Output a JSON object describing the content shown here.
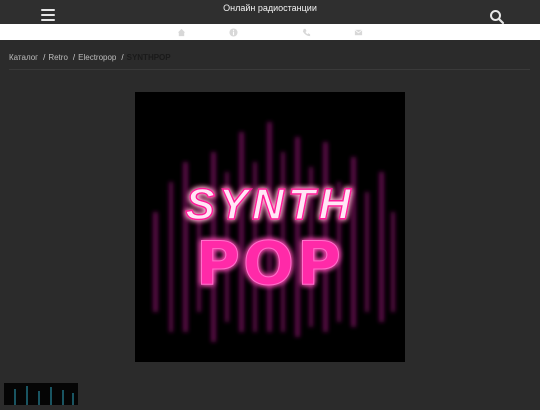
{
  "header": {
    "title": "Онлайн радиостанции",
    "menu_icon": "hamburger-icon",
    "search_icon": "search-icon"
  },
  "iconbar": {
    "icons": [
      "home-icon",
      "info-icon",
      "phone-icon",
      "mail-icon"
    ]
  },
  "breadcrumb": {
    "items": [
      "Каталог",
      "Retro",
      "Electropop"
    ],
    "separator": "/",
    "current": "SYNTHPOP"
  },
  "cover": {
    "line1": "SYNTH",
    "line2": "POP"
  },
  "colors": {
    "accent": "#ff1e9a",
    "background": "#2b2b2b"
  }
}
